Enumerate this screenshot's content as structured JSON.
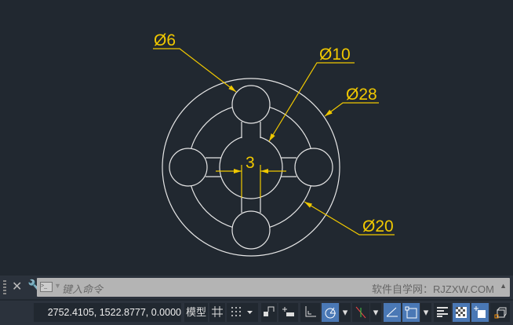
{
  "drawing": {
    "labels": {
      "small_holes": "Ø6",
      "inner": "Ø10",
      "outer": "Ø28",
      "middle": "Ø20",
      "bar_width": "3"
    },
    "colors": {
      "geometry": "#e6e6e6",
      "dimension": "#f0c800",
      "background": "#212830"
    }
  },
  "command_line": {
    "placeholder": "键入命令",
    "watermark": "软件自学网：RJZXW.COM"
  },
  "status_bar": {
    "coordinates": "2752.4105, 1522.8777, 0.0000",
    "model_label": "模型",
    "buttons": [
      "grid",
      "snap",
      "infer-constraints",
      "dynamic-input",
      "ortho",
      "polar",
      "isodraw",
      "object-snap-tracking",
      "object-snap",
      "lineweight",
      "transparency",
      "selection-cycling",
      "3d-osnap"
    ],
    "active": [
      "polar",
      "object-snap-tracking",
      "object-snap",
      "transparency",
      "selection-cycling"
    ]
  }
}
